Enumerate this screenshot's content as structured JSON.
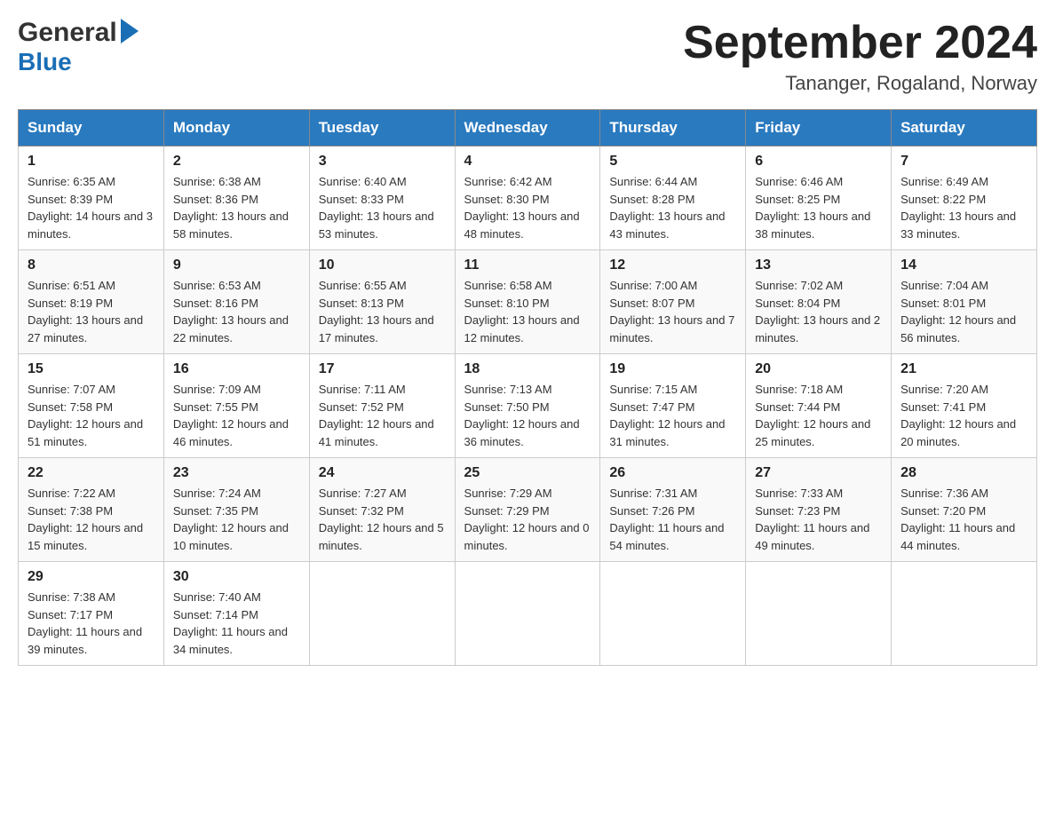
{
  "header": {
    "logo_general": "General",
    "logo_blue": "Blue",
    "month_title": "September 2024",
    "location": "Tananger, Rogaland, Norway"
  },
  "days_of_week": [
    "Sunday",
    "Monday",
    "Tuesday",
    "Wednesday",
    "Thursday",
    "Friday",
    "Saturday"
  ],
  "weeks": [
    [
      {
        "day": "1",
        "sunrise": "Sunrise: 6:35 AM",
        "sunset": "Sunset: 8:39 PM",
        "daylight": "Daylight: 14 hours and 3 minutes."
      },
      {
        "day": "2",
        "sunrise": "Sunrise: 6:38 AM",
        "sunset": "Sunset: 8:36 PM",
        "daylight": "Daylight: 13 hours and 58 minutes."
      },
      {
        "day": "3",
        "sunrise": "Sunrise: 6:40 AM",
        "sunset": "Sunset: 8:33 PM",
        "daylight": "Daylight: 13 hours and 53 minutes."
      },
      {
        "day": "4",
        "sunrise": "Sunrise: 6:42 AM",
        "sunset": "Sunset: 8:30 PM",
        "daylight": "Daylight: 13 hours and 48 minutes."
      },
      {
        "day": "5",
        "sunrise": "Sunrise: 6:44 AM",
        "sunset": "Sunset: 8:28 PM",
        "daylight": "Daylight: 13 hours and 43 minutes."
      },
      {
        "day": "6",
        "sunrise": "Sunrise: 6:46 AM",
        "sunset": "Sunset: 8:25 PM",
        "daylight": "Daylight: 13 hours and 38 minutes."
      },
      {
        "day": "7",
        "sunrise": "Sunrise: 6:49 AM",
        "sunset": "Sunset: 8:22 PM",
        "daylight": "Daylight: 13 hours and 33 minutes."
      }
    ],
    [
      {
        "day": "8",
        "sunrise": "Sunrise: 6:51 AM",
        "sunset": "Sunset: 8:19 PM",
        "daylight": "Daylight: 13 hours and 27 minutes."
      },
      {
        "day": "9",
        "sunrise": "Sunrise: 6:53 AM",
        "sunset": "Sunset: 8:16 PM",
        "daylight": "Daylight: 13 hours and 22 minutes."
      },
      {
        "day": "10",
        "sunrise": "Sunrise: 6:55 AM",
        "sunset": "Sunset: 8:13 PM",
        "daylight": "Daylight: 13 hours and 17 minutes."
      },
      {
        "day": "11",
        "sunrise": "Sunrise: 6:58 AM",
        "sunset": "Sunset: 8:10 PM",
        "daylight": "Daylight: 13 hours and 12 minutes."
      },
      {
        "day": "12",
        "sunrise": "Sunrise: 7:00 AM",
        "sunset": "Sunset: 8:07 PM",
        "daylight": "Daylight: 13 hours and 7 minutes."
      },
      {
        "day": "13",
        "sunrise": "Sunrise: 7:02 AM",
        "sunset": "Sunset: 8:04 PM",
        "daylight": "Daylight: 13 hours and 2 minutes."
      },
      {
        "day": "14",
        "sunrise": "Sunrise: 7:04 AM",
        "sunset": "Sunset: 8:01 PM",
        "daylight": "Daylight: 12 hours and 56 minutes."
      }
    ],
    [
      {
        "day": "15",
        "sunrise": "Sunrise: 7:07 AM",
        "sunset": "Sunset: 7:58 PM",
        "daylight": "Daylight: 12 hours and 51 minutes."
      },
      {
        "day": "16",
        "sunrise": "Sunrise: 7:09 AM",
        "sunset": "Sunset: 7:55 PM",
        "daylight": "Daylight: 12 hours and 46 minutes."
      },
      {
        "day": "17",
        "sunrise": "Sunrise: 7:11 AM",
        "sunset": "Sunset: 7:52 PM",
        "daylight": "Daylight: 12 hours and 41 minutes."
      },
      {
        "day": "18",
        "sunrise": "Sunrise: 7:13 AM",
        "sunset": "Sunset: 7:50 PM",
        "daylight": "Daylight: 12 hours and 36 minutes."
      },
      {
        "day": "19",
        "sunrise": "Sunrise: 7:15 AM",
        "sunset": "Sunset: 7:47 PM",
        "daylight": "Daylight: 12 hours and 31 minutes."
      },
      {
        "day": "20",
        "sunrise": "Sunrise: 7:18 AM",
        "sunset": "Sunset: 7:44 PM",
        "daylight": "Daylight: 12 hours and 25 minutes."
      },
      {
        "day": "21",
        "sunrise": "Sunrise: 7:20 AM",
        "sunset": "Sunset: 7:41 PM",
        "daylight": "Daylight: 12 hours and 20 minutes."
      }
    ],
    [
      {
        "day": "22",
        "sunrise": "Sunrise: 7:22 AM",
        "sunset": "Sunset: 7:38 PM",
        "daylight": "Daylight: 12 hours and 15 minutes."
      },
      {
        "day": "23",
        "sunrise": "Sunrise: 7:24 AM",
        "sunset": "Sunset: 7:35 PM",
        "daylight": "Daylight: 12 hours and 10 minutes."
      },
      {
        "day": "24",
        "sunrise": "Sunrise: 7:27 AM",
        "sunset": "Sunset: 7:32 PM",
        "daylight": "Daylight: 12 hours and 5 minutes."
      },
      {
        "day": "25",
        "sunrise": "Sunrise: 7:29 AM",
        "sunset": "Sunset: 7:29 PM",
        "daylight": "Daylight: 12 hours and 0 minutes."
      },
      {
        "day": "26",
        "sunrise": "Sunrise: 7:31 AM",
        "sunset": "Sunset: 7:26 PM",
        "daylight": "Daylight: 11 hours and 54 minutes."
      },
      {
        "day": "27",
        "sunrise": "Sunrise: 7:33 AM",
        "sunset": "Sunset: 7:23 PM",
        "daylight": "Daylight: 11 hours and 49 minutes."
      },
      {
        "day": "28",
        "sunrise": "Sunrise: 7:36 AM",
        "sunset": "Sunset: 7:20 PM",
        "daylight": "Daylight: 11 hours and 44 minutes."
      }
    ],
    [
      {
        "day": "29",
        "sunrise": "Sunrise: 7:38 AM",
        "sunset": "Sunset: 7:17 PM",
        "daylight": "Daylight: 11 hours and 39 minutes."
      },
      {
        "day": "30",
        "sunrise": "Sunrise: 7:40 AM",
        "sunset": "Sunset: 7:14 PM",
        "daylight": "Daylight: 11 hours and 34 minutes."
      },
      null,
      null,
      null,
      null,
      null
    ]
  ]
}
